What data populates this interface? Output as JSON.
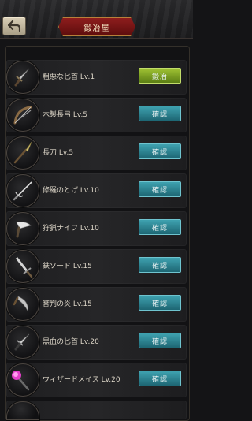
{
  "header": {
    "title": "鍛冶屋",
    "back_icon": "back-arrow-icon"
  },
  "items": [
    {
      "name": "粗悪な匕首 Lv.1",
      "action": "鍛冶",
      "action_type": "forge",
      "icon": "dagger-icon"
    },
    {
      "name": "木製長弓 Lv.5",
      "action": "確認",
      "action_type": "check",
      "icon": "bow-icon"
    },
    {
      "name": "長刀 Lv.5",
      "action": "確認",
      "action_type": "check",
      "icon": "naginata-icon"
    },
    {
      "name": "修羅のとげ Lv.10",
      "action": "確認",
      "action_type": "check",
      "icon": "rapier-icon"
    },
    {
      "name": "狩猟ナイフ Lv.10",
      "action": "確認",
      "action_type": "check",
      "icon": "hunting-knife-icon"
    },
    {
      "name": "鉄ソード Lv.15",
      "action": "確認",
      "action_type": "check",
      "icon": "iron-sword-icon"
    },
    {
      "name": "審判の炎 Lv.15",
      "action": "確認",
      "action_type": "check",
      "icon": "curved-blade-icon"
    },
    {
      "name": "黒血の匕首 Lv.20",
      "action": "確認",
      "action_type": "check",
      "icon": "black-dagger-icon"
    },
    {
      "name": "ウィザードメイス Lv.20",
      "action": "確認",
      "action_type": "check",
      "icon": "wizard-mace-icon"
    }
  ],
  "colors": {
    "check_button": "#2a8594",
    "forge_button": "#7fa322",
    "title_banner": "#7a1515"
  }
}
